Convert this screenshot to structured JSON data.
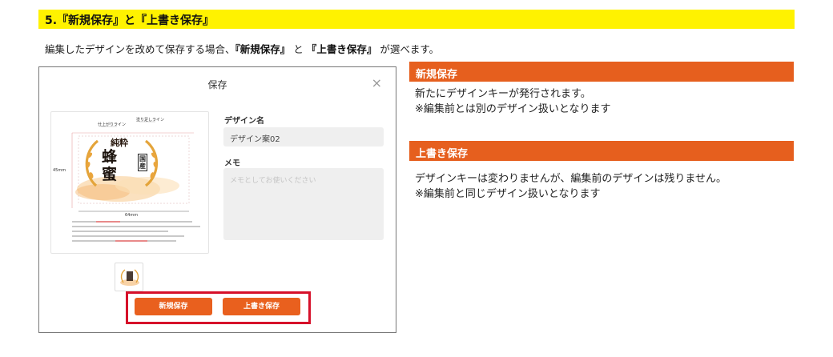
{
  "section": {
    "title": "5.『新規保存』と『上書き保存』"
  },
  "intro": {
    "prefix": "編集したデザインを改めて保存する場合、",
    "bracket_open": "『",
    "new_save": "新規保存",
    "bracket_close": "』",
    "and": "と",
    "overwrite": "上書き保存",
    "suffix": "が選べます。"
  },
  "dialog": {
    "title": "保存",
    "close_label": "×",
    "design_name_label": "デザイン名",
    "design_name_value": "デザイン案02",
    "memo_label": "メモ",
    "memo_placeholder": "メモとしてお使いください",
    "new_save_button": "新規保存",
    "overwrite_button": "上書き保存",
    "preview": {
      "text_junsei": "純粋",
      "text_hachimitsu": "蜂蜜",
      "text_kokusan": "国産",
      "dimension_width": "64mm",
      "dimension_height": "45mm",
      "guide_bleed": "塗り足しライン",
      "guide_trim": "仕上がりライン"
    }
  },
  "new_save_info": {
    "heading": "新規保存",
    "line1": "新たにデザインキーが発行されます。",
    "line2": "※編集前とは別のデザイン扱いとなります"
  },
  "overwrite_info": {
    "heading": "上書き保存",
    "line1": "デザインキーは変わりませんが、編集前のデザインは残りません。",
    "line2": "※編集前と同じデザイン扱いとなります"
  },
  "colors": {
    "highlight": "#fff200",
    "accent": "#e65f1e",
    "frame": "#d6102a"
  }
}
